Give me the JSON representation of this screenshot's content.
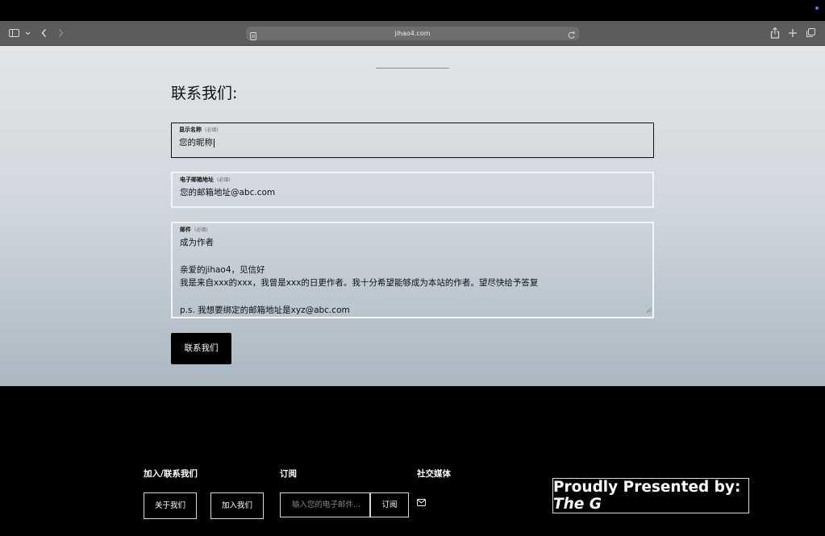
{
  "browser": {
    "url": "jihao4.com"
  },
  "contact": {
    "heading": "联系我们:",
    "fields": [
      {
        "label": "显示名称",
        "required": "(必填)",
        "value": "您的昵称"
      },
      {
        "label": "电子邮箱地址",
        "required": "(必填)",
        "value": "您的邮箱地址@abc.com"
      },
      {
        "label": "邮件",
        "required": "(必填)",
        "value": "成为作者\n\n亲爱的jihao4，见信好\n我是来自xxx的xxx，我曾是xxx的日更作者。我十分希望能够成为本站的作者。望尽快给予答复\n\np.s. 我想要绑定的邮箱地址是xyz@abc.com"
      }
    ],
    "submit_label": "联系我们"
  },
  "footer": {
    "join": {
      "heading": "加入/联系我们",
      "about_label": "关于我们",
      "join_label": "加入我们"
    },
    "subscribe": {
      "heading": "订阅",
      "placeholder": "输入您的电子邮件...",
      "button_label": "订阅"
    },
    "social": {
      "heading": "社交媒体",
      "icons": [
        "mail-icon"
      ]
    },
    "presented": {
      "line1": "Proudly Presented by:",
      "line2": "The G"
    }
  }
}
